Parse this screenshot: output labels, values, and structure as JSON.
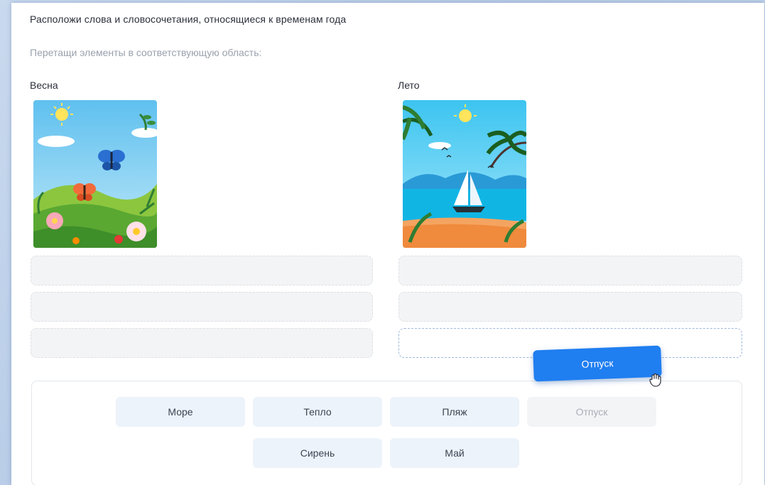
{
  "task": {
    "title": "Расположи слова и словосочетания, относящиеся к временам года",
    "hint": "Перетащи элементы в соответствующую область:"
  },
  "columns": [
    {
      "label": "Весна",
      "image": "spring-illustration"
    },
    {
      "label": "Лето",
      "image": "summer-illustration"
    }
  ],
  "word_bank": [
    {
      "label": "Море",
      "state": "available"
    },
    {
      "label": "Тепло",
      "state": "available"
    },
    {
      "label": "Пляж",
      "state": "available"
    },
    {
      "label": "Отпуск",
      "state": "dragging-placeholder"
    },
    {
      "label": "Сирень",
      "state": "available"
    },
    {
      "label": "Май",
      "state": "available"
    }
  ],
  "dragged_item": {
    "label": "Отпуск",
    "target": "Лето",
    "cursor": "grab-hand-icon"
  },
  "colors": {
    "accent": "#1f7ef0",
    "chip_bg": "#edf3fb",
    "slot_bg": "#f3f4f6",
    "text": "#2b2f3a",
    "hint_text": "#9aa1ad"
  }
}
